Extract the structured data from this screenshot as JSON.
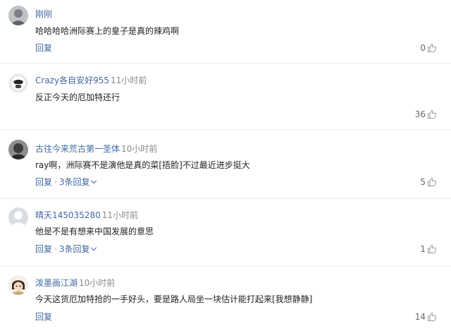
{
  "comments": [
    {
      "username": "刚刚",
      "time": "",
      "text": "哈哈哈哈洲际赛上的皇子是真的辣鸡啊",
      "reply_label": "回复",
      "replies_label": "",
      "likes": "0",
      "like_icon": "thumbs-up-icon"
    },
    {
      "username": "Crazy各自安好955",
      "time": "11小时前",
      "text": "反正今天的厄加特还行",
      "reply_label": "回复",
      "replies_label": "",
      "likes": "36",
      "like_icon": "thumbs-up-icon"
    },
    {
      "username": "古往今来荒古第一圣体",
      "time": "10小时前",
      "text": "ray啊，洲际赛不是演他是真的菜[捂脸]不过最近进步挺大",
      "reply_label": "回复",
      "replies_label": "3条回复",
      "likes": "5",
      "like_icon": "thumbs-up-icon"
    },
    {
      "username": "晴天145035280",
      "time": "11小时前",
      "text": "他是不是有想来中国发展的意思",
      "reply_label": "回复",
      "replies_label": "3条回复",
      "likes": "1",
      "like_icon": "thumbs-up-icon"
    },
    {
      "username": "泼墨画江湖",
      "time": "10小时前",
      "text": "今天这货厄加特抢的一手好头，要是路人局坐一块估计能打起来[我想静静]",
      "reply_label": "回复",
      "replies_label": "",
      "likes": "14",
      "like_icon": "thumbs-up-icon"
    }
  ],
  "colors": {
    "link": "#41679f",
    "meta": "#8a8a8a",
    "text": "#222222",
    "divider": "#ececec"
  },
  "separator": "·"
}
